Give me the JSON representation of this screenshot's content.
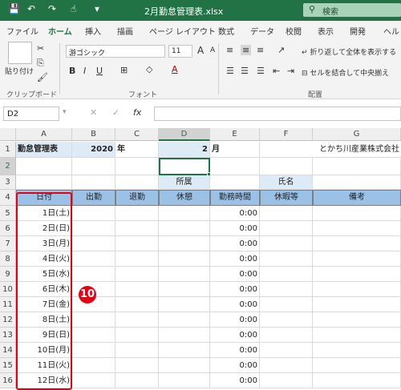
{
  "titlebar": {
    "filename": "2月勤怠管理表.xlsx",
    "search_label": "検索",
    "save_glyph": "💾",
    "undo_glyph": "↶",
    "redo_glyph": "↷",
    "touch_glyph": "☝",
    "customize_glyph": "▾"
  },
  "tabs": [
    "ファイル",
    "ホーム",
    "挿入",
    "描画",
    "ページ レイアウト",
    "数式",
    "データ",
    "校閲",
    "表示",
    "開発",
    "ヘル"
  ],
  "ribbon": {
    "paste_label": "貼り付け",
    "clipboard_label": "クリップボード",
    "font_name": "游ゴシック",
    "font_size": "11",
    "font_group_label": "フォント",
    "bold": "B",
    "italic": "I",
    "underline": "U",
    "font_color_glyph": "A",
    "wrap_text_label": "折り返して全体を表示する",
    "merge_label": "セルを結合して中央揃え",
    "alignment_group_label": "配置",
    "grow_font": "A",
    "shrink_font": "A"
  },
  "formula_bar": {
    "name_box": "D2",
    "cancel_glyph": "✕",
    "enter_glyph": "✓",
    "fx_label": "fx",
    "value": ""
  },
  "columns": [
    "A",
    "B",
    "C",
    "D",
    "E",
    "F",
    "G"
  ],
  "selected_column": "D",
  "selected_row": "2",
  "rows_numbers": [
    "1",
    "2",
    "3",
    "4",
    "5",
    "6",
    "7",
    "8",
    "9",
    "10",
    "11",
    "12",
    "13",
    "14",
    "15",
    "16"
  ],
  "sheet": {
    "row1": {
      "title": "勤怠管理表",
      "year": "2020",
      "year_unit": "年",
      "month": "2",
      "month_unit": "月",
      "company": "とかち川産業株式会社"
    },
    "row3": {
      "affiliation": "所属",
      "name": "氏名"
    },
    "header": [
      "日付",
      "出勤",
      "退勤",
      "休憩",
      "勤務時間",
      "休暇等",
      "備考"
    ],
    "days": [
      {
        "date": "1日(土)",
        "hours": "0:00"
      },
      {
        "date": "2日(日)",
        "hours": "0:00"
      },
      {
        "date": "3日(月)",
        "hours": "0:00"
      },
      {
        "date": "4日(火)",
        "hours": "0:00"
      },
      {
        "date": "5日(水)",
        "hours": "0:00"
      },
      {
        "date": "6日(木)",
        "hours": "0:00"
      },
      {
        "date": "7日(金)",
        "hours": "0:00"
      },
      {
        "date": "8日(土)",
        "hours": "0:00"
      },
      {
        "date": "9日(日)",
        "hours": "0:00"
      },
      {
        "date": "10日(月)",
        "hours": "0:00"
      },
      {
        "date": "11日(火)",
        "hours": "0:00"
      },
      {
        "date": "12日(水)",
        "hours": "0:00"
      }
    ]
  },
  "annotation": {
    "badge": "10"
  },
  "colors": {
    "excel_green": "#217346",
    "header_blue": "#9bc2e6",
    "light_blue": "#ddebf7",
    "highlight_red": "#e60012"
  }
}
